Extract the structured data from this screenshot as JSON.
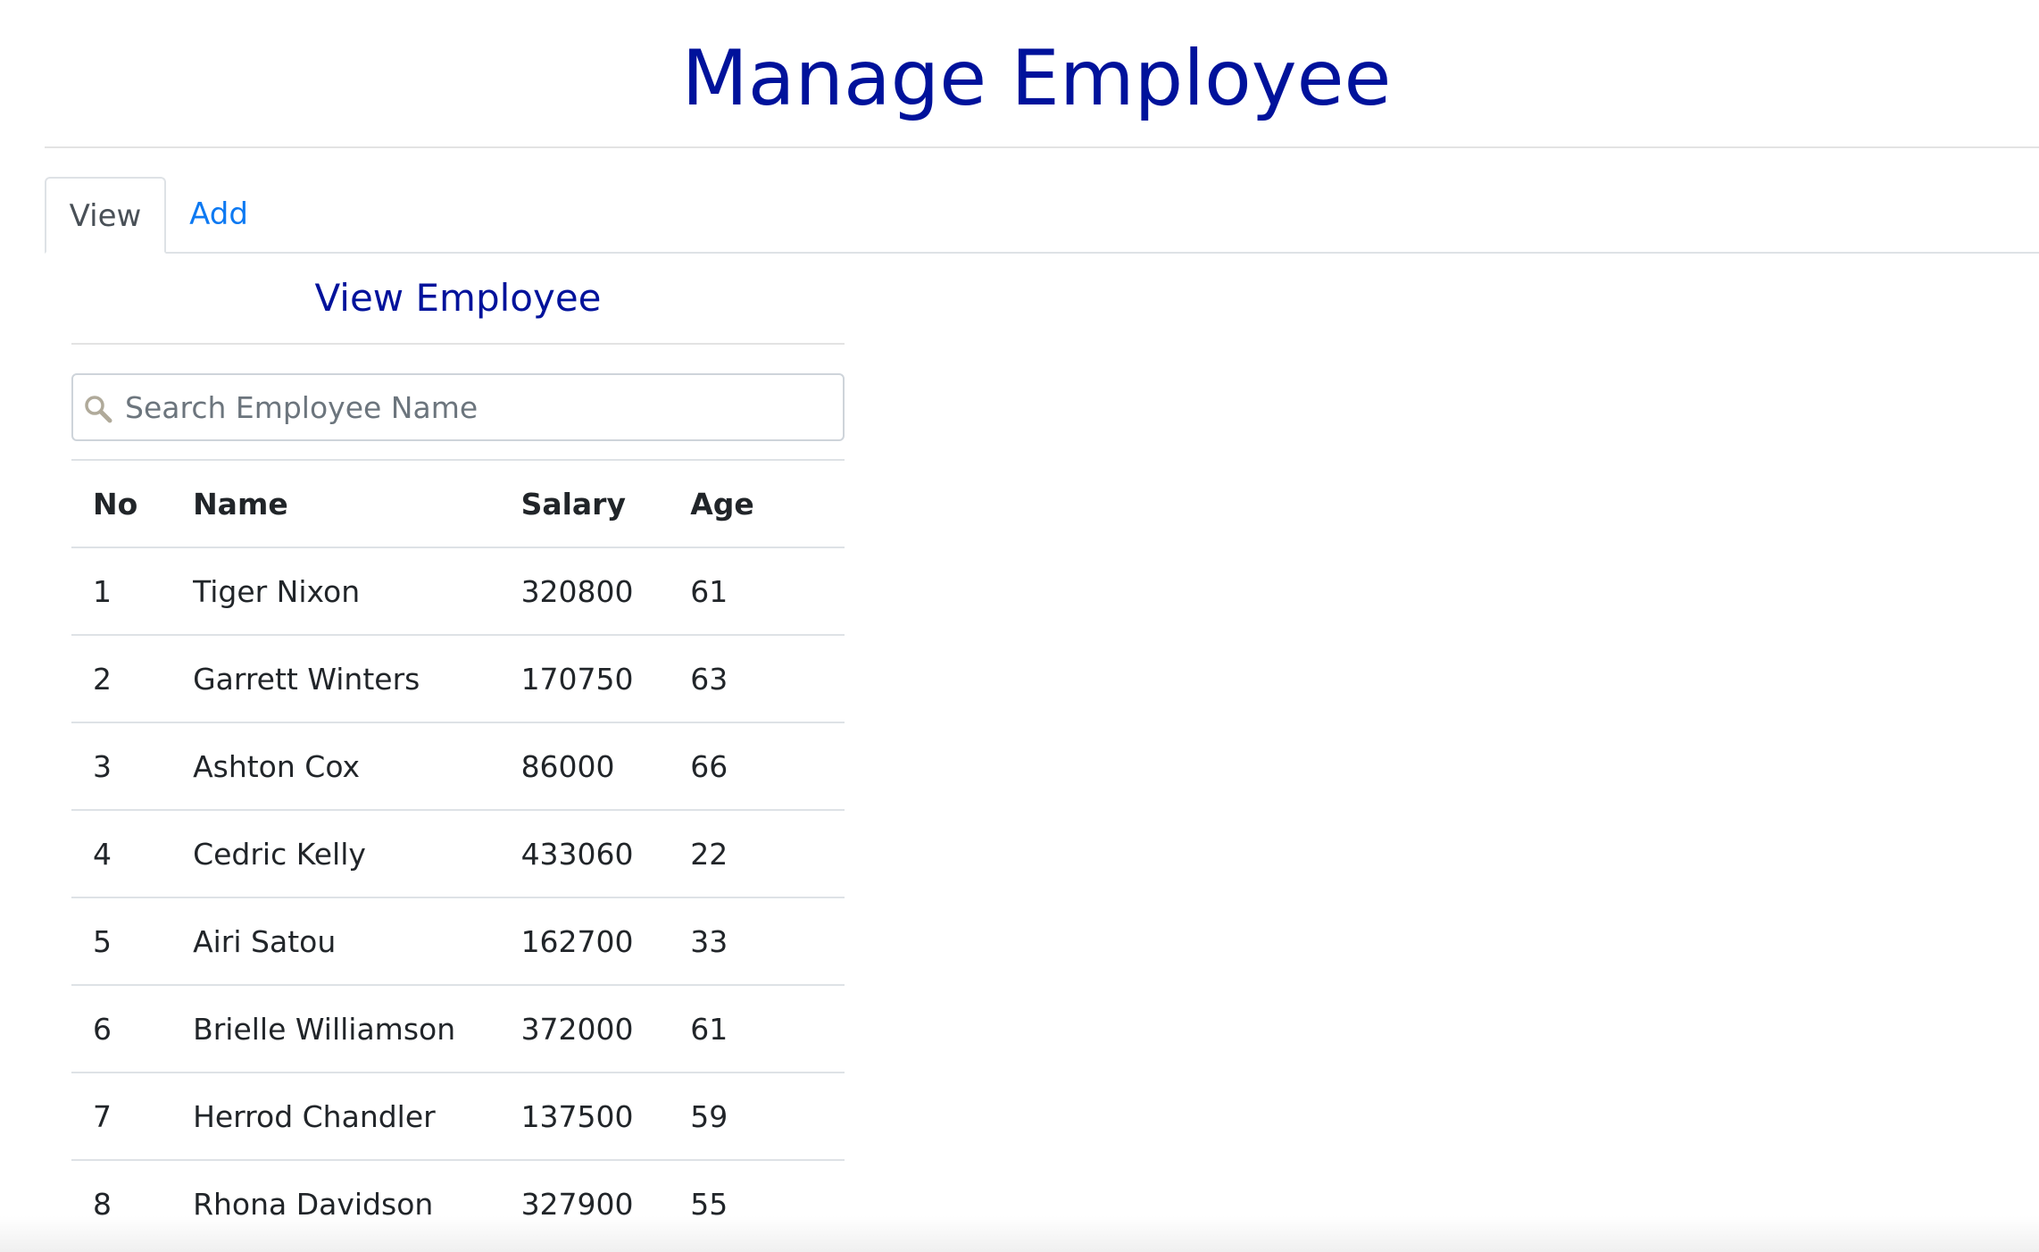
{
  "header": {
    "title": "Manage Employee"
  },
  "tabs": [
    {
      "label": "View",
      "active": true
    },
    {
      "label": "Add",
      "active": false
    }
  ],
  "panel": {
    "title": "View Employee"
  },
  "search": {
    "placeholder": "Search Employee Name",
    "value": ""
  },
  "table": {
    "headers": {
      "no": "No",
      "name": "Name",
      "salary": "Salary",
      "age": "Age"
    },
    "rows": [
      {
        "no": "1",
        "name": "Tiger Nixon",
        "salary": "320800",
        "age": "61"
      },
      {
        "no": "2",
        "name": "Garrett Winters",
        "salary": "170750",
        "age": "63"
      },
      {
        "no": "3",
        "name": "Ashton Cox",
        "salary": "86000",
        "age": "66"
      },
      {
        "no": "4",
        "name": "Cedric Kelly",
        "salary": "433060",
        "age": "22"
      },
      {
        "no": "5",
        "name": "Airi Satou",
        "salary": "162700",
        "age": "33"
      },
      {
        "no": "6",
        "name": "Brielle Williamson",
        "salary": "372000",
        "age": "61"
      },
      {
        "no": "7",
        "name": "Herrod Chandler",
        "salary": "137500",
        "age": "59"
      },
      {
        "no": "8",
        "name": "Rhona Davidson",
        "salary": "327900",
        "age": "55"
      }
    ]
  },
  "colors": {
    "title": "#00129b",
    "link": "#0d79f2",
    "border": "#dee2e6"
  },
  "icons": {
    "search": "search-icon"
  }
}
